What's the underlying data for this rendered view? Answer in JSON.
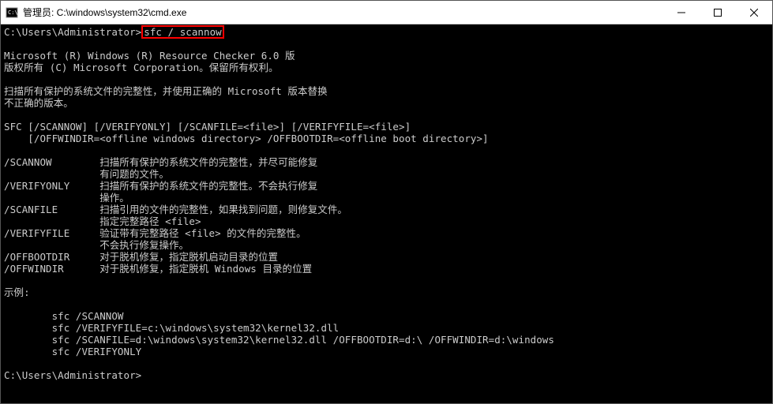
{
  "titlebar": {
    "title": "管理员: C:\\windows\\system32\\cmd.exe"
  },
  "terminal": {
    "prompt1_prefix": "C:\\Users\\Administrator>",
    "prompt1_command": "sfc / scannow",
    "blank": "",
    "l1": "Microsoft (R) Windows (R) Resource Checker 6.0 版",
    "l2": "版权所有 (C) Microsoft Corporation。保留所有权利。",
    "l3": "扫描所有保护的系统文件的完整性，并使用正确的 Microsoft 版本替换",
    "l4": "不正确的版本。",
    "l5": "SFC [/SCANNOW] [/VERIFYONLY] [/SCANFILE=<file>] [/VERIFYFILE=<file>]",
    "l6": "    [/OFFWINDIR=<offline windows directory> /OFFBOOTDIR=<offline boot directory>]",
    "l7": "/SCANNOW        扫描所有保护的系统文件的完整性，并尽可能修复",
    "l8": "                有问题的文件。",
    "l9": "/VERIFYONLY     扫描所有保护的系统文件的完整性。不会执行修复",
    "l10": "                操作。",
    "l11": "/SCANFILE       扫描引用的文件的完整性，如果找到问题，则修复文件。",
    "l12": "                指定完整路径 <file>",
    "l13": "/VERIFYFILE     验证带有完整路径 <file> 的文件的完整性。",
    "l14": "                不会执行修复操作。",
    "l15": "/OFFBOOTDIR     对于脱机修复，指定脱机启动目录的位置",
    "l16": "/OFFWINDIR      对于脱机修复，指定脱机 Windows 目录的位置",
    "l17": "示例:",
    "l18": "        sfc /SCANNOW",
    "l19": "        sfc /VERIFYFILE=c:\\windows\\system32\\kernel32.dll",
    "l20": "        sfc /SCANFILE=d:\\windows\\system32\\kernel32.dll /OFFBOOTDIR=d:\\ /OFFWINDIR=d:\\windows",
    "l21": "        sfc /VERIFYONLY",
    "prompt2": "C:\\Users\\Administrator>"
  }
}
